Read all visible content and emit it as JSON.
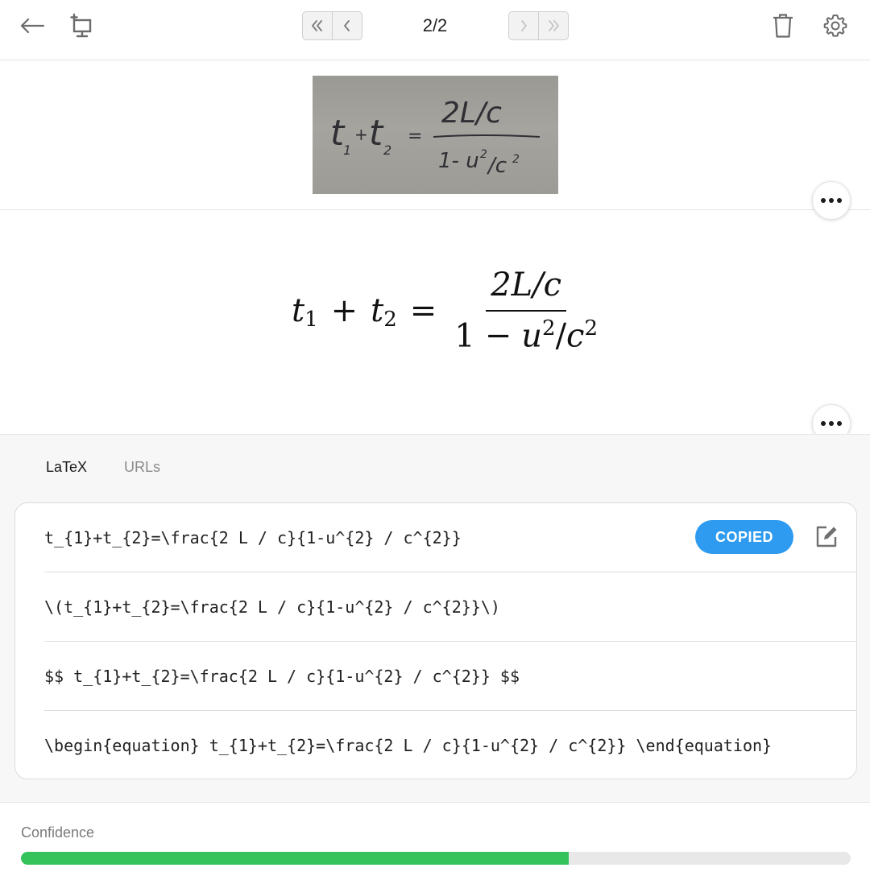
{
  "toolbar": {
    "back_icon": "arrow-left-icon",
    "snip_icon": "screen-snip-icon",
    "first_icon": "double-chevron-left-icon",
    "prev_icon": "chevron-left-icon",
    "page_indicator": "2/2",
    "next_icon": "chevron-right-icon",
    "last_icon": "double-chevron-right-icon",
    "delete_icon": "trash-icon",
    "settings_icon": "gear-icon"
  },
  "source_image": {
    "handwriting": [
      "t",
      "1",
      "+",
      "t",
      "2",
      "=",
      "2L/c",
      "1- u",
      "2",
      "/c",
      "2"
    ]
  },
  "rendered_equation": {
    "lhs_t": "t",
    "sub1": "1",
    "plus": "+",
    "sub2": "2",
    "equals": "=",
    "numerator": "2L/c",
    "den_one": "1",
    "den_minus": "−",
    "den_u": "u",
    "den_exp": "2",
    "den_slash": "/",
    "den_c": "c",
    "den_c_exp": "2"
  },
  "tabs": [
    {
      "label": "LaTeX",
      "active": true
    },
    {
      "label": "URLs",
      "active": false
    }
  ],
  "latex_formats": [
    {
      "text": "t_{1}+t_{2}=\\frac{2 L / c}{1-u^{2} / c^{2}}"
    },
    {
      "text": "\\(t_{1}+t_{2}=\\frac{2 L / c}{1-u^{2} / c^{2}}\\)"
    },
    {
      "text": "$$ t_{1}+t_{2}=\\frac{2 L / c}{1-u^{2} / c^{2}} $$"
    },
    {
      "text": "\\begin{equation} t_{1}+t_{2}=\\frac{2 L / c}{1-u^{2} / c^{2}} \\end{equation}"
    }
  ],
  "copied_label": "COPIED",
  "confidence": {
    "label": "Confidence",
    "value": 0.66
  },
  "colors": {
    "accent_blue": "#2e9bf0",
    "confidence_green": "#34c35a"
  }
}
